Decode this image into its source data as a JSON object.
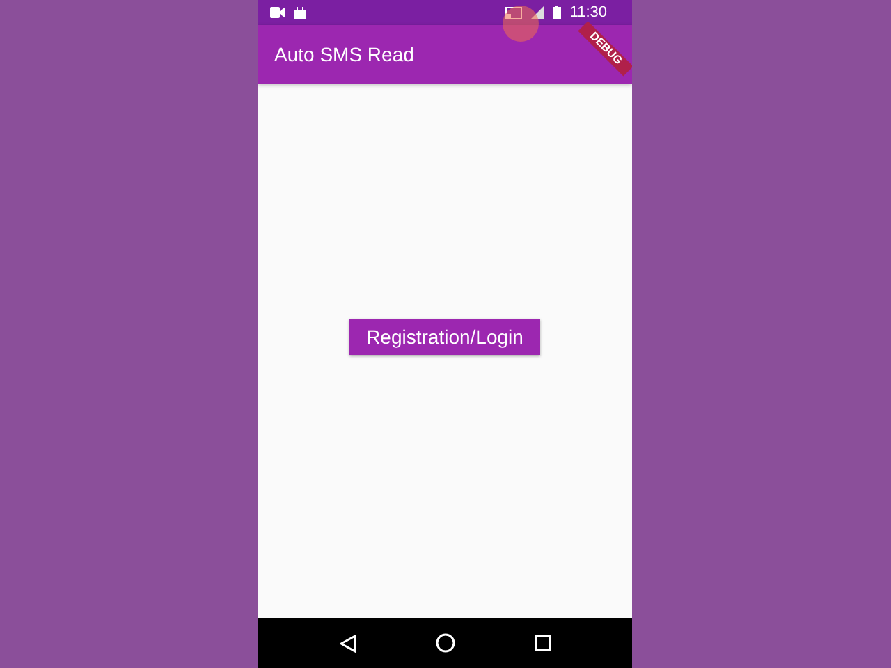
{
  "status_bar": {
    "time": "11:30"
  },
  "app_bar": {
    "title": "Auto SMS Read"
  },
  "debug_banner": {
    "label": "DEBUG"
  },
  "body": {
    "button": "Registration/Login"
  }
}
